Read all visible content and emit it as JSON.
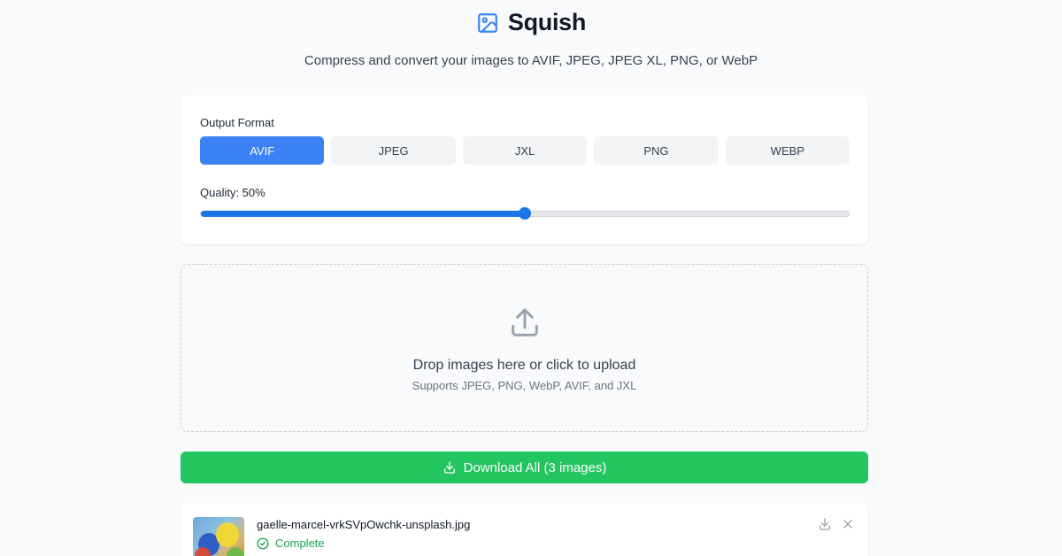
{
  "app": {
    "title": "Squish",
    "subtitle": "Compress and convert your images to AVIF, JPEG, JPEG XL, PNG, or WebP",
    "logo_icon": "image-icon",
    "accent_color": "#3b82f6"
  },
  "settings": {
    "format_label": "Output Format",
    "formats": [
      {
        "label": "AVIF",
        "active": true
      },
      {
        "label": "JPEG",
        "active": false
      },
      {
        "label": "JXL",
        "active": false
      },
      {
        "label": "PNG",
        "active": false
      },
      {
        "label": "WEBP",
        "active": false
      }
    ],
    "quality_label": "Quality: 50%",
    "quality_value": 50
  },
  "dropzone": {
    "icon": "upload-icon",
    "title": "Drop images here or click to upload",
    "subtitle": "Supports JPEG, PNG, WebP, AVIF, and JXL"
  },
  "download_all": {
    "label": "Download All (3 images)",
    "icon": "download-icon",
    "color": "#22c55e"
  },
  "files": [
    {
      "name": "gaelle-marcel-vrkSVpOwchk-unsplash.jpg",
      "status": "Complete",
      "status_icon": "check-circle-icon",
      "status_color": "#16a34a"
    }
  ]
}
